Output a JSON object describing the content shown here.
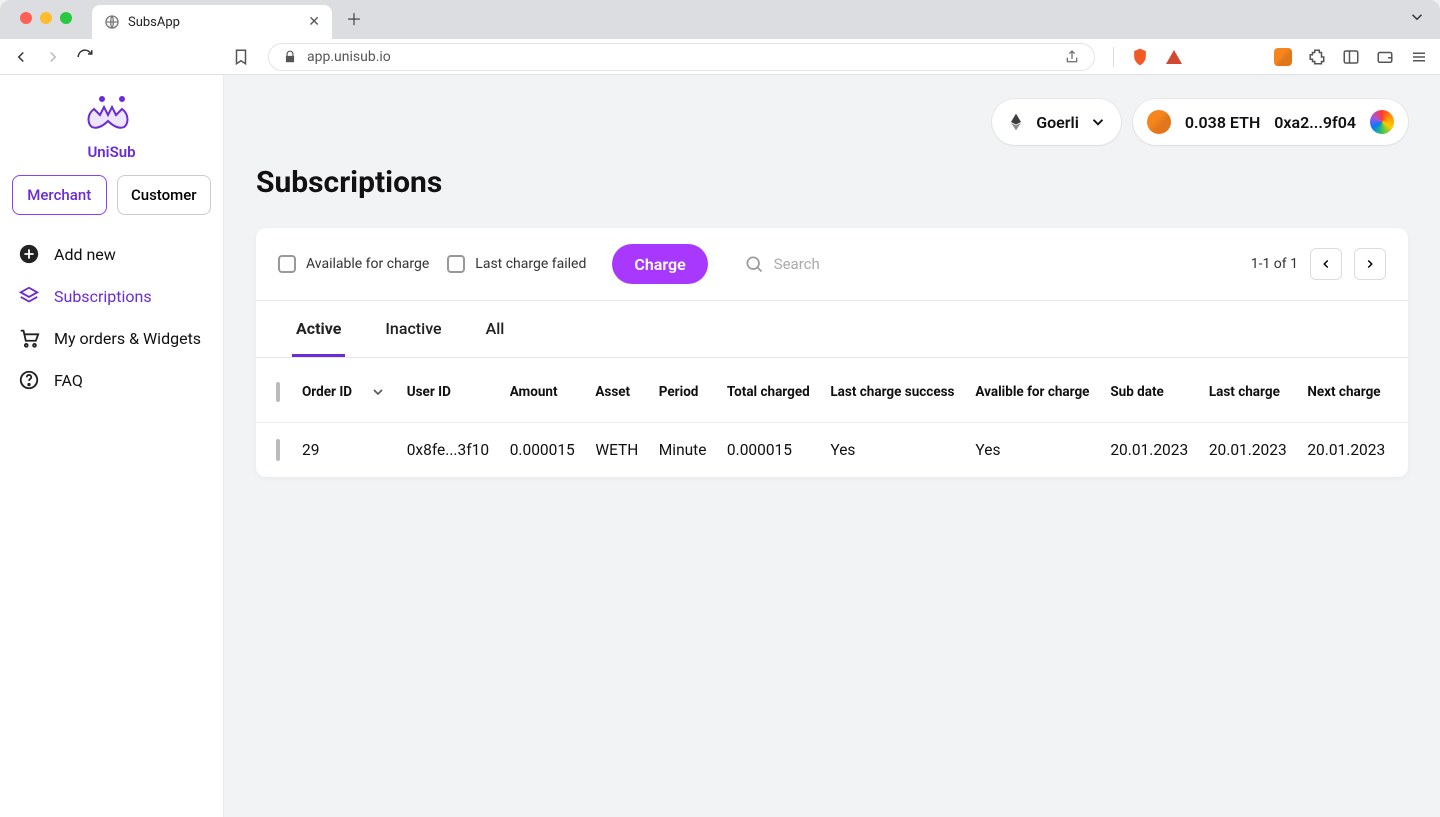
{
  "browser": {
    "tab_title": "SubsApp",
    "url": "app.unisub.io"
  },
  "brand": "UniSub",
  "roles": {
    "merchant": "Merchant",
    "customer": "Customer"
  },
  "sidebar": {
    "items": [
      {
        "label": "Add new"
      },
      {
        "label": "Subscriptions"
      },
      {
        "label": "My orders & Widgets"
      },
      {
        "label": "FAQ"
      }
    ]
  },
  "header": {
    "network": "Goerli",
    "balance": "0.038 ETH",
    "address": "0xa2...9f04"
  },
  "page": {
    "title": "Subscriptions"
  },
  "filters": {
    "available_label": "Available for charge",
    "failed_label": "Last charge failed",
    "charge_button": "Charge",
    "search_placeholder": "Search"
  },
  "pagination": {
    "text": "1-1 of 1"
  },
  "tabs": [
    {
      "label": "Active",
      "active": true
    },
    {
      "label": "Inactive",
      "active": false
    },
    {
      "label": "All",
      "active": false
    }
  ],
  "table": {
    "headers": {
      "order_id": "Order ID",
      "user_id": "User ID",
      "amount": "Amount",
      "asset": "Asset",
      "period": "Period",
      "total_charged": "Total charged",
      "last_charge_success": "Last charge success",
      "available_for_charge": "Avalible for charge",
      "sub_date": "Sub date",
      "last_charge": "Last charge",
      "next_charge": "Next charge"
    },
    "rows": [
      {
        "order_id": "29",
        "user_id": "0x8fe...3f10",
        "amount": "0.000015",
        "asset": "WETH",
        "period": "Minute",
        "total_charged": "0.000015",
        "last_charge_success": "Yes",
        "available_for_charge": "Yes",
        "sub_date": "20.01.2023",
        "last_charge": "20.01.2023",
        "next_charge": "20.01.2023"
      }
    ]
  }
}
